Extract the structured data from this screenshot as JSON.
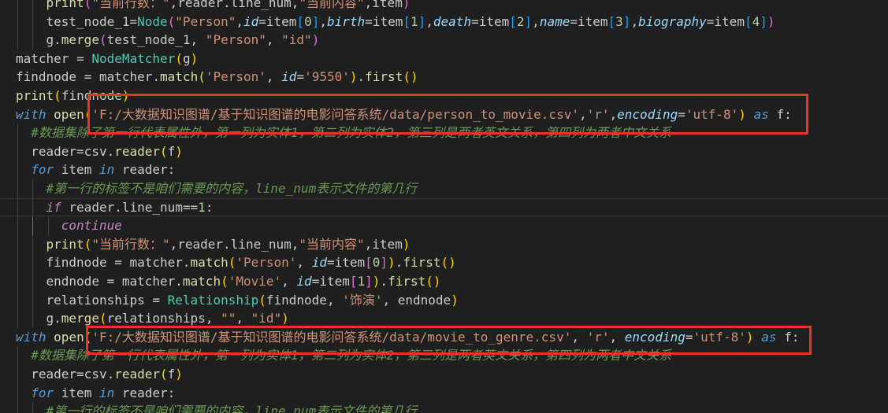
{
  "editor": {
    "lines": [
      {
        "indent": 4,
        "tokens": [
          [
            "fn",
            "print"
          ],
          [
            "br2",
            "("
          ],
          [
            "str",
            "\"当前行数：\""
          ],
          [
            "pun",
            ",reader.line_num,"
          ],
          [
            "str",
            "\"当前内容\""
          ],
          [
            "pun",
            ",item"
          ],
          [
            "br2",
            ")"
          ]
        ]
      },
      {
        "indent": 4,
        "tokens": [
          [
            "var",
            "test_node_1"
          ],
          [
            "pun",
            "="
          ],
          [
            "cls",
            "Node"
          ],
          [
            "br2",
            "("
          ],
          [
            "str",
            "\"Person\""
          ],
          [
            "pun",
            ","
          ],
          [
            "prm",
            "id"
          ],
          [
            "pun",
            "=item"
          ],
          [
            "br3",
            "["
          ],
          [
            "num",
            "0"
          ],
          [
            "br3",
            "]"
          ],
          [
            "pun",
            ","
          ],
          [
            "prm",
            "birth"
          ],
          [
            "pun",
            "=item"
          ],
          [
            "br3",
            "["
          ],
          [
            "num",
            "1"
          ],
          [
            "br3",
            "]"
          ],
          [
            "pun",
            ","
          ],
          [
            "prm",
            "death"
          ],
          [
            "pun",
            "=item"
          ],
          [
            "br3",
            "["
          ],
          [
            "num",
            "2"
          ],
          [
            "br3",
            "]"
          ],
          [
            "pun",
            ","
          ],
          [
            "prm",
            "name"
          ],
          [
            "pun",
            "=item"
          ],
          [
            "br3",
            "["
          ],
          [
            "num",
            "3"
          ],
          [
            "br3",
            "]"
          ],
          [
            "pun",
            ","
          ],
          [
            "prm",
            "biography"
          ],
          [
            "pun",
            "=item"
          ],
          [
            "br3",
            "["
          ],
          [
            "num",
            "4"
          ],
          [
            "br3",
            "]"
          ],
          [
            "br2",
            ")"
          ]
        ]
      },
      {
        "indent": 4,
        "tokens": [
          [
            "pun",
            "g."
          ],
          [
            "fn",
            "merge"
          ],
          [
            "br2",
            "("
          ],
          [
            "pun",
            "test_node_1, "
          ],
          [
            "str",
            "\"Person\""
          ],
          [
            "pun",
            ", "
          ],
          [
            "str",
            "\"id\""
          ],
          [
            "br2",
            ")"
          ]
        ]
      },
      {
        "indent": 0,
        "tokens": [
          [
            "var",
            "matcher"
          ],
          [
            "pun",
            " = "
          ],
          [
            "cls",
            "NodeMatcher"
          ],
          [
            "br1",
            "("
          ],
          [
            "pun",
            "g"
          ],
          [
            "br1",
            ")"
          ]
        ]
      },
      {
        "indent": 0,
        "tokens": [
          [
            "var",
            "findnode"
          ],
          [
            "pun",
            " = matcher."
          ],
          [
            "fn",
            "match"
          ],
          [
            "br1",
            "("
          ],
          [
            "str",
            "'Person'"
          ],
          [
            "pun",
            ", "
          ],
          [
            "prm",
            "id"
          ],
          [
            "pun",
            "="
          ],
          [
            "str",
            "'9550'"
          ],
          [
            "br1",
            ")"
          ],
          [
            "pun",
            "."
          ],
          [
            "fn",
            "first"
          ],
          [
            "br1",
            "("
          ],
          [
            "br1",
            ")"
          ]
        ]
      },
      {
        "indent": 0,
        "tokens": [
          [
            "fn",
            "print"
          ],
          [
            "br1",
            "("
          ],
          [
            "pun",
            "findnode"
          ],
          [
            "br1",
            ")"
          ]
        ]
      },
      {
        "indent": 0,
        "tokens": [
          [
            "kw",
            "with"
          ],
          [
            "pun",
            " "
          ],
          [
            "fn",
            "open"
          ],
          [
            "br1",
            "("
          ],
          [
            "str",
            "'F:/大数据知识图谱/基于知识图谱的电影问答系统/data/person_to_movie.csv'"
          ],
          [
            "pun",
            ","
          ],
          [
            "str",
            "'r'"
          ],
          [
            "pun",
            ","
          ],
          [
            "prm",
            "encoding"
          ],
          [
            "pun",
            "="
          ],
          [
            "str",
            "'utf-8'"
          ],
          [
            "br1",
            ")"
          ],
          [
            "pun",
            " "
          ],
          [
            "kw",
            "as"
          ],
          [
            "pun",
            " f:"
          ]
        ]
      },
      {
        "indent": 2,
        "tokens": [
          [
            "cmt",
            "#数据集除了第一行代表属性外，第一列为实体1，第二列为实体2，第三列是两者英文关系，第四列为两者中文关系"
          ]
        ]
      },
      {
        "indent": 2,
        "tokens": [
          [
            "pun",
            "reader=csv."
          ],
          [
            "fn",
            "reader"
          ],
          [
            "br1",
            "("
          ],
          [
            "pun",
            "f"
          ],
          [
            "br1",
            ")"
          ]
        ]
      },
      {
        "indent": 2,
        "tokens": [
          [
            "kw",
            "for"
          ],
          [
            "pun",
            " item "
          ],
          [
            "kw",
            "in"
          ],
          [
            "pun",
            " reader:"
          ]
        ]
      },
      {
        "indent": 4,
        "tokens": [
          [
            "cmt",
            "#第一行的标签不是咱们需要的内容，line_num表示文件的第几行"
          ]
        ]
      },
      {
        "indent": 4,
        "current": true,
        "tokens": [
          [
            "ctl",
            "if"
          ],
          [
            "pun",
            " reader.line_num=="
          ],
          [
            "num",
            "1"
          ],
          [
            "pun",
            ":"
          ]
        ]
      },
      {
        "indent": 6,
        "tokens": [
          [
            "ctl",
            "continue"
          ]
        ]
      },
      {
        "indent": 4,
        "tokens": [
          [
            "fn",
            "print"
          ],
          [
            "br1",
            "("
          ],
          [
            "str",
            "\"当前行数：\""
          ],
          [
            "pun",
            ",reader.line_num,"
          ],
          [
            "str",
            "\"当前内容\""
          ],
          [
            "pun",
            ",item"
          ],
          [
            "br1",
            ")"
          ]
        ]
      },
      {
        "indent": 4,
        "tokens": [
          [
            "pun",
            "findnode = matcher."
          ],
          [
            "fn",
            "match"
          ],
          [
            "br1",
            "("
          ],
          [
            "str",
            "'Person'"
          ],
          [
            "pun",
            ", "
          ],
          [
            "prm",
            "id"
          ],
          [
            "pun",
            "=item"
          ],
          [
            "br2",
            "["
          ],
          [
            "num",
            "0"
          ],
          [
            "br2",
            "]"
          ],
          [
            "br1",
            ")"
          ],
          [
            "pun",
            "."
          ],
          [
            "fn",
            "first"
          ],
          [
            "br1",
            "("
          ],
          [
            "br1",
            ")"
          ]
        ]
      },
      {
        "indent": 4,
        "tokens": [
          [
            "pun",
            "endnode = matcher."
          ],
          [
            "fn",
            "match"
          ],
          [
            "br1",
            "("
          ],
          [
            "str",
            "'Movie'"
          ],
          [
            "pun",
            ", "
          ],
          [
            "prm",
            "id"
          ],
          [
            "pun",
            "=item"
          ],
          [
            "br2",
            "["
          ],
          [
            "num",
            "1"
          ],
          [
            "br2",
            "]"
          ],
          [
            "br1",
            ")"
          ],
          [
            "pun",
            "."
          ],
          [
            "fn",
            "first"
          ],
          [
            "br1",
            "("
          ],
          [
            "br1",
            ")"
          ]
        ]
      },
      {
        "indent": 4,
        "tokens": [
          [
            "pun",
            "relationships = "
          ],
          [
            "cls",
            "Relationship"
          ],
          [
            "br1",
            "("
          ],
          [
            "pun",
            "findnode, "
          ],
          [
            "str",
            "'饰演'"
          ],
          [
            "pun",
            ", endnode"
          ],
          [
            "br1",
            ")"
          ]
        ]
      },
      {
        "indent": 4,
        "tokens": [
          [
            "pun",
            "g."
          ],
          [
            "fn",
            "merge"
          ],
          [
            "br1",
            "("
          ],
          [
            "pun",
            "relationships, "
          ],
          [
            "str",
            "\"\""
          ],
          [
            "pun",
            ", "
          ],
          [
            "str",
            "\"id\""
          ],
          [
            "br1",
            ")"
          ]
        ]
      },
      {
        "indent": 0,
        "tokens": [
          [
            "kw",
            "with"
          ],
          [
            "pun",
            " "
          ],
          [
            "fn",
            "open"
          ],
          [
            "br1",
            "("
          ],
          [
            "str",
            "'F:/大数据知识图谱/基于知识图谱的电影问答系统/data/movie_to_genre.csv'"
          ],
          [
            "pun",
            ", "
          ],
          [
            "str",
            "'r'"
          ],
          [
            "pun",
            ", "
          ],
          [
            "prm",
            "encoding"
          ],
          [
            "pun",
            "="
          ],
          [
            "str",
            "'utf-8'"
          ],
          [
            "br1",
            ")"
          ],
          [
            "pun",
            " "
          ],
          [
            "kw",
            "as"
          ],
          [
            "pun",
            " f:"
          ]
        ]
      },
      {
        "indent": 2,
        "tokens": [
          [
            "cmt",
            "#数据集除了第一行代表属性外，第一列为实体1，第二列为实体2，第三列是两者英文关系，第四列为两者中文关系"
          ]
        ]
      },
      {
        "indent": 2,
        "tokens": [
          [
            "pun",
            "reader=csv."
          ],
          [
            "fn",
            "reader"
          ],
          [
            "br1",
            "("
          ],
          [
            "pun",
            "f"
          ],
          [
            "br1",
            ")"
          ]
        ]
      },
      {
        "indent": 2,
        "tokens": [
          [
            "kw",
            "for"
          ],
          [
            "pun",
            " item "
          ],
          [
            "kw",
            "in"
          ],
          [
            "pun",
            " reader:"
          ]
        ]
      },
      {
        "indent": 4,
        "tokens": [
          [
            "cmt",
            "#第一行的标签不是咱们需要的内容，line_num表示文件的第几行"
          ]
        ]
      }
    ]
  },
  "theme": {
    "background": "#1f1f1f",
    "annotation_color": "#e53528"
  }
}
